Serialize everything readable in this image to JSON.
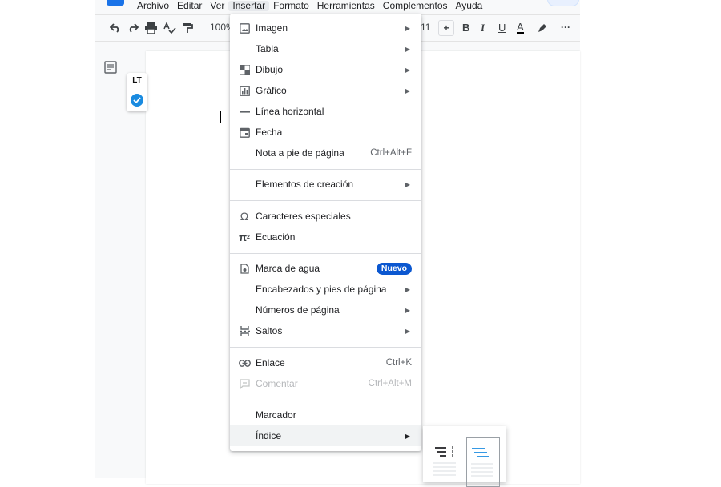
{
  "menubar": {
    "items": [
      "Archivo",
      "Editar",
      "Ver",
      "Insertar",
      "Formato",
      "Herramientas",
      "Complementos",
      "Ayuda"
    ],
    "active_index": 3
  },
  "toolbar": {
    "zoom": "100%",
    "font_size": "11",
    "bold": "B",
    "italic": "I",
    "underline": "U",
    "text_color": "A",
    "more": "···",
    "plus": "+"
  },
  "insert_menu": {
    "items": [
      {
        "label": "Imagen",
        "icon": "image-icon",
        "submenu": true
      },
      {
        "label": "Tabla",
        "icon": "",
        "submenu": true
      },
      {
        "label": "Dibujo",
        "icon": "drawing-icon",
        "submenu": true
      },
      {
        "label": "Gráfico",
        "icon": "chart-icon",
        "submenu": true
      },
      {
        "label": "Línea horizontal",
        "icon": "horizontal-line-icon",
        "submenu": false
      },
      {
        "label": "Fecha",
        "icon": "calendar-icon",
        "submenu": false
      },
      {
        "label": "Nota a pie de página",
        "icon": "",
        "shortcut": "Ctrl+Alt+F"
      },
      {
        "label": "Elementos de creación",
        "icon": "",
        "submenu": true
      },
      {
        "label": "Caracteres especiales",
        "icon": "omega-icon",
        "submenu": false
      },
      {
        "label": "Ecuación",
        "icon": "pi-icon",
        "submenu": false
      },
      {
        "label": "Marca de agua",
        "icon": "watermark-icon",
        "badge": "Nuevo"
      },
      {
        "label": "Encabezados y pies de página",
        "icon": "",
        "submenu": true
      },
      {
        "label": "Números de página",
        "icon": "",
        "submenu": true
      },
      {
        "label": "Saltos",
        "icon": "page-break-icon",
        "submenu": true
      },
      {
        "label": "Enlace",
        "icon": "link-icon",
        "shortcut": "Ctrl+K"
      },
      {
        "label": "Comentar",
        "icon": "comment-icon",
        "shortcut": "Ctrl+Alt+M",
        "disabled": true
      },
      {
        "label": "Marcador",
        "icon": "",
        "submenu": false
      },
      {
        "label": "Índice",
        "icon": "",
        "submenu": true,
        "highlighted": true
      }
    ]
  },
  "languagetool": {
    "logo": "LT"
  },
  "colors": {
    "accent": "#1a73e8",
    "badge": "#0b57d0",
    "toc_blue": "#1a8be0"
  }
}
